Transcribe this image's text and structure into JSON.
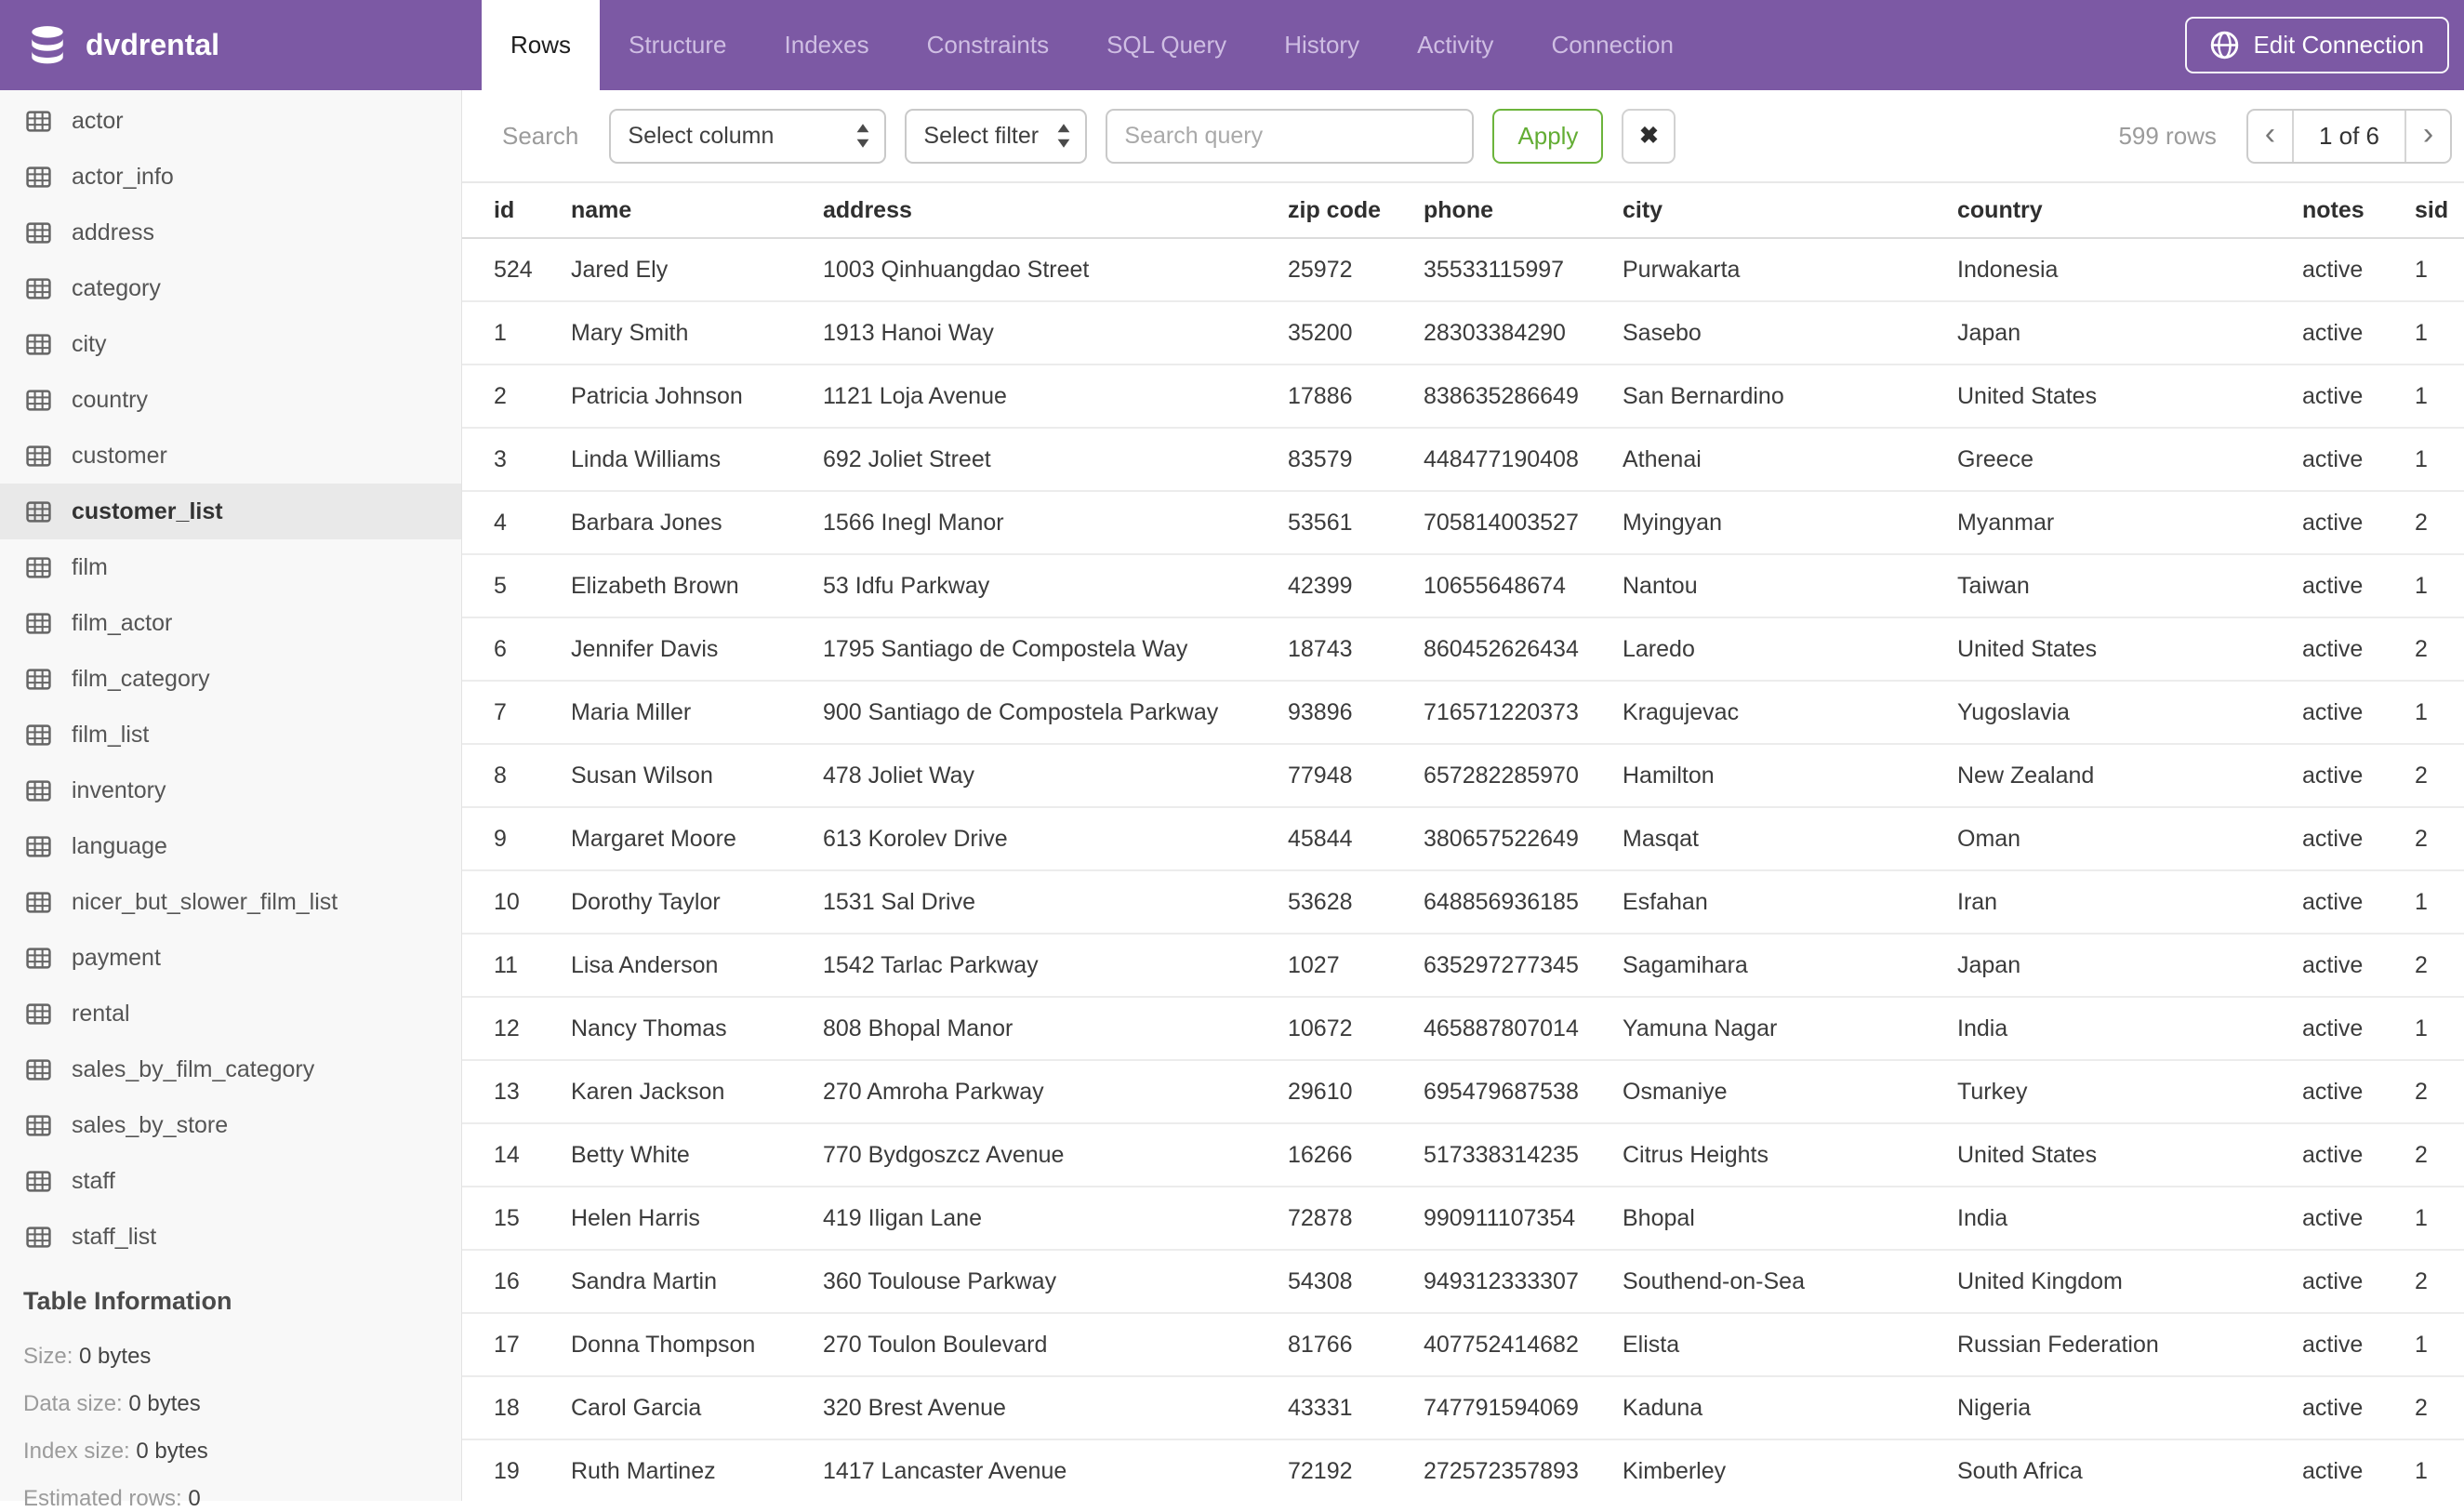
{
  "header": {
    "app_title": "dvdrental",
    "tabs": [
      "Rows",
      "Structure",
      "Indexes",
      "Constraints",
      "SQL Query",
      "History",
      "Activity",
      "Connection"
    ],
    "active_tab": "Rows",
    "edit_connection_label": "Edit Connection"
  },
  "toolbar": {
    "search_label": "Search",
    "select_column_value": "Select column",
    "select_filter_value": "Select filter",
    "search_placeholder": "Search query",
    "apply_label": "Apply",
    "clear_label": "✖",
    "rows_count": "599 rows",
    "pagination": {
      "prev": "‹",
      "current": "1 of 6",
      "next": "›"
    }
  },
  "sidebar": {
    "tables": [
      "actor",
      "actor_info",
      "address",
      "category",
      "city",
      "country",
      "customer",
      "customer_list",
      "film",
      "film_actor",
      "film_category",
      "film_list",
      "inventory",
      "language",
      "nicer_but_slower_film_list",
      "payment",
      "rental",
      "sales_by_film_category",
      "sales_by_store",
      "staff",
      "staff_list"
    ],
    "selected_table": "customer_list",
    "table_information": {
      "title": "Table Information",
      "rows": [
        {
          "label": "Size:",
          "value": "0 bytes"
        },
        {
          "label": "Data size:",
          "value": "0 bytes"
        },
        {
          "label": "Index size:",
          "value": "0 bytes"
        },
        {
          "label": "Estimated rows:",
          "value": "0"
        }
      ]
    }
  },
  "table": {
    "columns": [
      "id",
      "name",
      "address",
      "zip code",
      "phone",
      "city",
      "country",
      "notes",
      "sid"
    ],
    "rows": [
      [
        "524",
        "Jared Ely",
        "1003 Qinhuangdao Street",
        "25972",
        "35533115997",
        "Purwakarta",
        "Indonesia",
        "active",
        "1"
      ],
      [
        "1",
        "Mary Smith",
        "1913 Hanoi Way",
        "35200",
        "28303384290",
        "Sasebo",
        "Japan",
        "active",
        "1"
      ],
      [
        "2",
        "Patricia Johnson",
        "1121 Loja Avenue",
        "17886",
        "838635286649",
        "San Bernardino",
        "United States",
        "active",
        "1"
      ],
      [
        "3",
        "Linda Williams",
        "692 Joliet Street",
        "83579",
        "448477190408",
        "Athenai",
        "Greece",
        "active",
        "1"
      ],
      [
        "4",
        "Barbara Jones",
        "1566 Inegl Manor",
        "53561",
        "705814003527",
        "Myingyan",
        "Myanmar",
        "active",
        "2"
      ],
      [
        "5",
        "Elizabeth Brown",
        "53 Idfu Parkway",
        "42399",
        "10655648674",
        "Nantou",
        "Taiwan",
        "active",
        "1"
      ],
      [
        "6",
        "Jennifer Davis",
        "1795 Santiago de Compostela Way",
        "18743",
        "860452626434",
        "Laredo",
        "United States",
        "active",
        "2"
      ],
      [
        "7",
        "Maria Miller",
        "900 Santiago de Compostela Parkway",
        "93896",
        "716571220373",
        "Kragujevac",
        "Yugoslavia",
        "active",
        "1"
      ],
      [
        "8",
        "Susan Wilson",
        "478 Joliet Way",
        "77948",
        "657282285970",
        "Hamilton",
        "New Zealand",
        "active",
        "2"
      ],
      [
        "9",
        "Margaret Moore",
        "613 Korolev Drive",
        "45844",
        "380657522649",
        "Masqat",
        "Oman",
        "active",
        "2"
      ],
      [
        "10",
        "Dorothy Taylor",
        "1531 Sal Drive",
        "53628",
        "648856936185",
        "Esfahan",
        "Iran",
        "active",
        "1"
      ],
      [
        "11",
        "Lisa Anderson",
        "1542 Tarlac Parkway",
        "1027",
        "635297277345",
        "Sagamihara",
        "Japan",
        "active",
        "2"
      ],
      [
        "12",
        "Nancy Thomas",
        "808 Bhopal Manor",
        "10672",
        "465887807014",
        "Yamuna Nagar",
        "India",
        "active",
        "1"
      ],
      [
        "13",
        "Karen Jackson",
        "270 Amroha Parkway",
        "29610",
        "695479687538",
        "Osmaniye",
        "Turkey",
        "active",
        "2"
      ],
      [
        "14",
        "Betty White",
        "770 Bydgoszcz Avenue",
        "16266",
        "517338314235",
        "Citrus Heights",
        "United States",
        "active",
        "2"
      ],
      [
        "15",
        "Helen Harris",
        "419 Iligan Lane",
        "72878",
        "990911107354",
        "Bhopal",
        "India",
        "active",
        "1"
      ],
      [
        "16",
        "Sandra Martin",
        "360 Toulouse Parkway",
        "54308",
        "949312333307",
        "Southend-on-Sea",
        "United Kingdom",
        "active",
        "2"
      ],
      [
        "17",
        "Donna Thompson",
        "270 Toulon Boulevard",
        "81766",
        "407752414682",
        "Elista",
        "Russian Federation",
        "active",
        "1"
      ],
      [
        "18",
        "Carol Garcia",
        "320 Brest Avenue",
        "43331",
        "747791594069",
        "Kaduna",
        "Nigeria",
        "active",
        "2"
      ],
      [
        "19",
        "Ruth Martinez",
        "1417 Lancaster Avenue",
        "72192",
        "272572357893",
        "Kimberley",
        "South Africa",
        "active",
        "1"
      ]
    ]
  },
  "colors": {
    "brand_purple": "#7C59A4",
    "tab_inactive_text": "#CFBEE3",
    "apply_green": "#6CB43C",
    "sidebar_bg": "#F8F8F8",
    "selected_item_bg": "#E9E9E9",
    "row_separator": "#ECECEC",
    "muted_text": "#9B9B9B"
  }
}
